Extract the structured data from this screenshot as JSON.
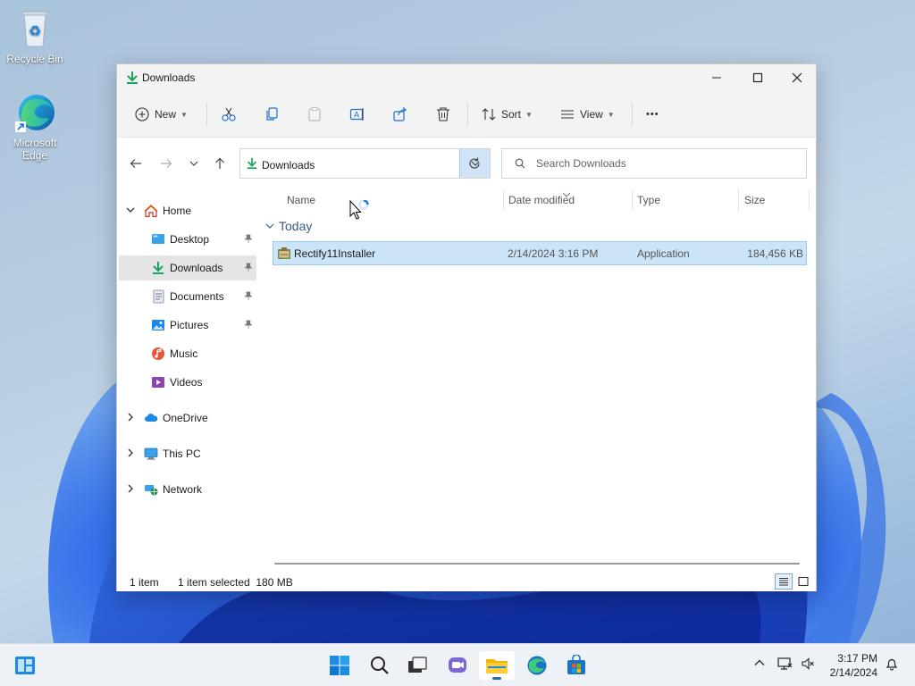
{
  "desktop": {
    "icons": [
      {
        "label": "Recycle Bin"
      },
      {
        "label": "Microsoft Edge"
      }
    ]
  },
  "window": {
    "title": "Downloads",
    "controls": {
      "minimize": "minimize-icon",
      "maximize": "maximize-icon",
      "close": "close-icon"
    }
  },
  "toolbar": {
    "new_label": "New",
    "sort_label": "Sort",
    "view_label": "View",
    "more_glyph": "•••"
  },
  "nav": {
    "address": "Downloads",
    "search_placeholder": "Search Downloads"
  },
  "sidebar": {
    "items": [
      {
        "label": "Home"
      },
      {
        "label": "Desktop"
      },
      {
        "label": "Downloads"
      },
      {
        "label": "Documents"
      },
      {
        "label": "Pictures"
      },
      {
        "label": "Music"
      },
      {
        "label": "Videos"
      },
      {
        "label": "OneDrive"
      },
      {
        "label": "This PC"
      },
      {
        "label": "Network"
      }
    ]
  },
  "content": {
    "columns": [
      "Name",
      "Date modified",
      "Type",
      "Size"
    ],
    "group": "Today",
    "rows": [
      {
        "name": "Rectify11Installer",
        "date": "2/14/2024 3:16 PM",
        "type": "Application",
        "size": "184,456 KB"
      }
    ]
  },
  "status": {
    "count": "1 item",
    "selected": "1 item selected  180 MB"
  },
  "taskbar": {
    "time": "3:17 PM",
    "date": "2/14/2024"
  },
  "colors": {
    "accent": "#0067c0",
    "selection": "#cce4f7",
    "download_green": "#1aa260"
  }
}
